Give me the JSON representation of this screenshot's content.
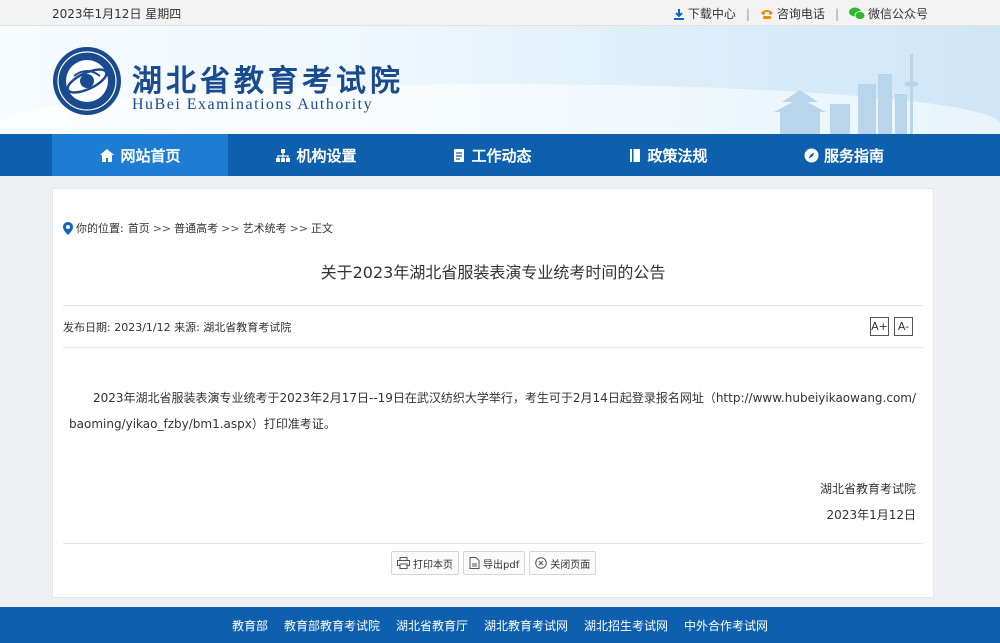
{
  "topbar": {
    "date": "2023年1月12日 星期四",
    "links": [
      {
        "label": "下载中心",
        "icon": "download-icon"
      },
      {
        "label": "咨询电话",
        "icon": "phone-icon"
      },
      {
        "label": "微信公众号",
        "icon": "wechat-icon"
      }
    ],
    "separator": "|"
  },
  "header": {
    "site_name": "湖北省教育考试院",
    "site_name_en": "HuBei Examinations Authority",
    "logo_icon": "emblem-logo-icon"
  },
  "nav": {
    "items": [
      {
        "label": "网站首页",
        "icon": "home-icon"
      },
      {
        "label": "机构设置",
        "icon": "org-chart-icon"
      },
      {
        "label": "工作动态",
        "icon": "document-icon"
      },
      {
        "label": "政策法规",
        "icon": "book-icon"
      },
      {
        "label": "服务指南",
        "icon": "compass-icon"
      }
    ],
    "active_index": 0
  },
  "breadcrumb": {
    "prefix": "你的位置:",
    "items": [
      "首页",
      "普通高考",
      "艺术统考",
      "正文"
    ],
    "separator": ">>"
  },
  "article": {
    "title": "关于2023年湖北省服装表演专业统考时间的公告",
    "meta": "发布日期: 2023/1/12 来源: 湖北省教育考试院",
    "font_increase": "A+",
    "font_decrease": "A-",
    "body": "2023年湖北省服装表演专业统考于2023年2月17日--19日在武汉纺织大学举行，考生可于2月14日起登录报名网址（http://www.hubeiyikaowang.com/baoming/yikao_fzby/bm1.aspx）打印准考证。",
    "signature": "湖北省教育考试院",
    "sign_date": "2023年1月12日"
  },
  "actions": [
    {
      "label": "打印本页",
      "icon": "printer-icon"
    },
    {
      "label": "导出pdf",
      "icon": "pdf-icon"
    },
    {
      "label": "关闭页面",
      "icon": "close-icon"
    }
  ],
  "footer": {
    "links": [
      "教育部",
      "教育部教育考试院",
      "湖北省教育厅",
      "湖北教育考试网",
      "湖北招生考试网",
      "中外合作考试网"
    ]
  },
  "colors": {
    "nav_bg": "#0e5fae",
    "nav_active": "#1c7dd3",
    "brand_text": "#1b4b8f"
  }
}
